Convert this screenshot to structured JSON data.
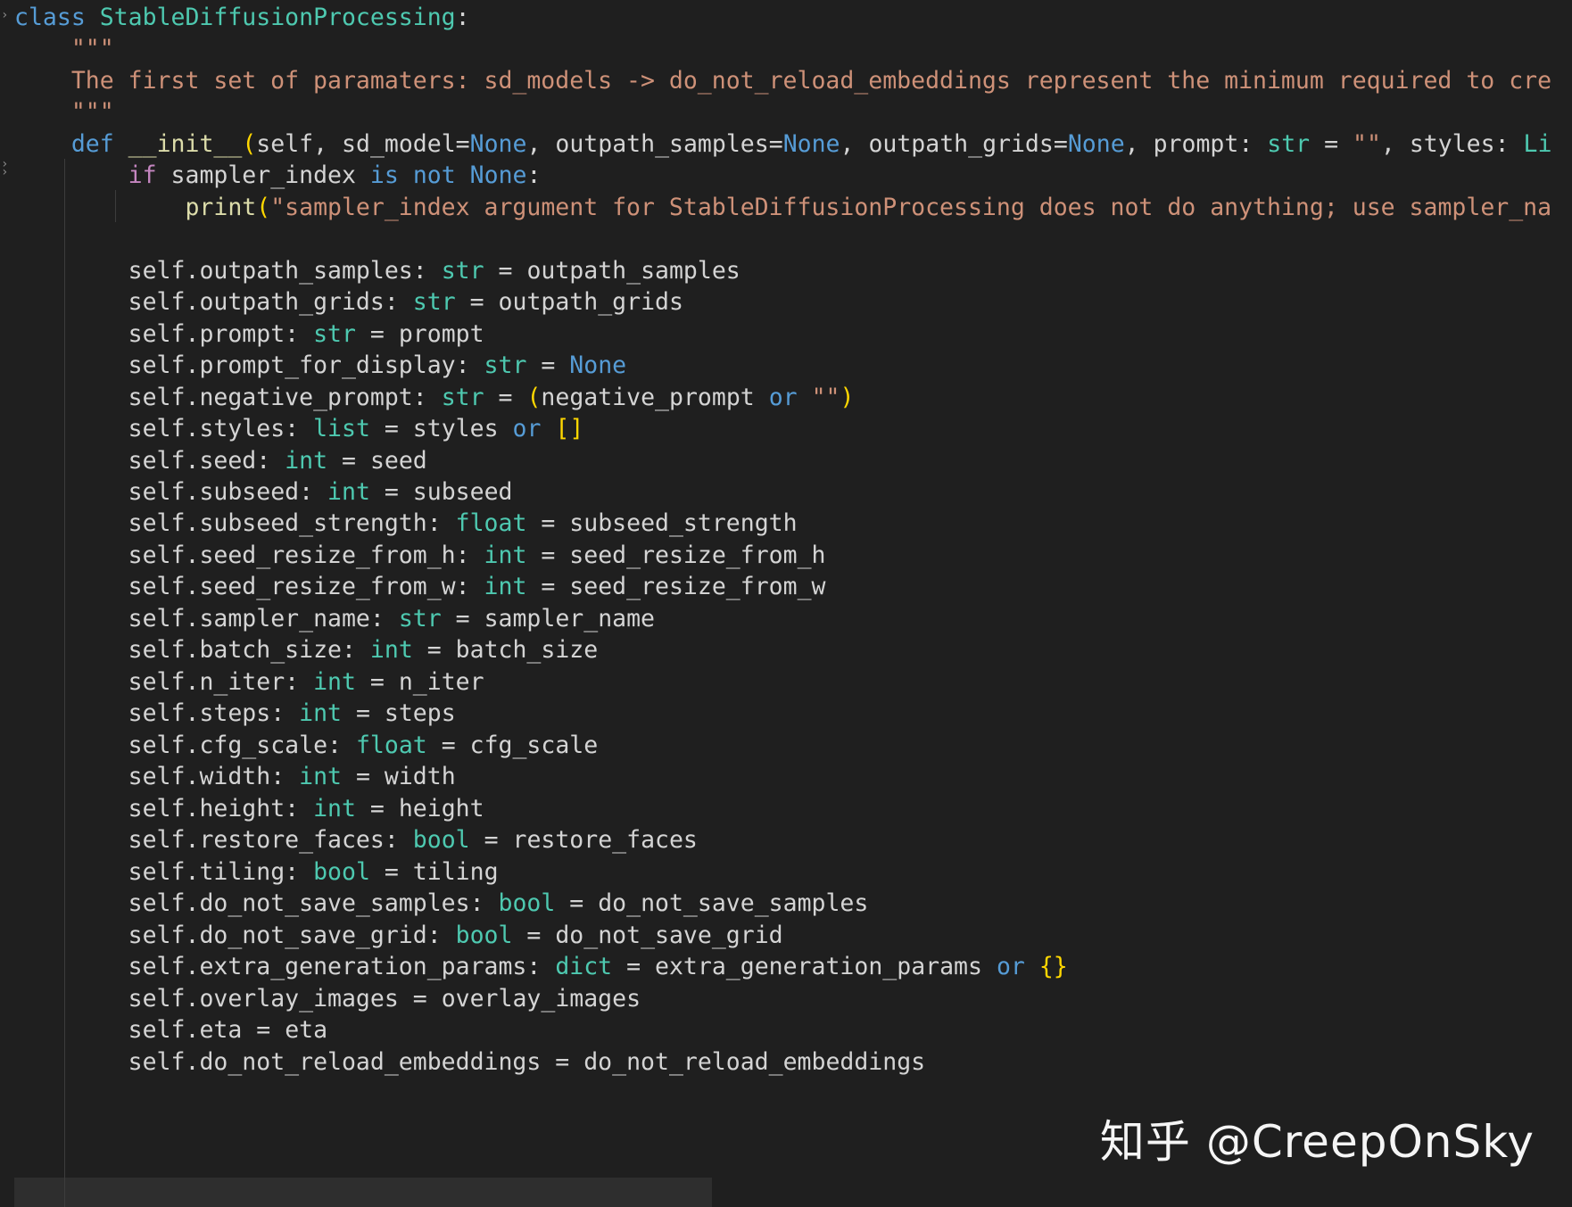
{
  "editor": {
    "language": "python",
    "lines": [
      "class StableDiffusionProcessing:",
      "    \"\"\"",
      "    The first set of paramaters: sd_models -> do_not_reload_embeddings represent the minimum required to cre",
      "    \"\"\"",
      "    def __init__(self, sd_model=None, outpath_samples=None, outpath_grids=None, prompt: str = \"\", styles: Li",
      "        if sampler_index is not None:",
      "            print(\"sampler_index argument for StableDiffusionProcessing does not do anything; use sampler_na",
      "",
      "        self.outpath_samples: str = outpath_samples",
      "        self.outpath_grids: str = outpath_grids",
      "        self.prompt: str = prompt",
      "        self.prompt_for_display: str = None",
      "        self.negative_prompt: str = (negative_prompt or \"\")",
      "        self.styles: list = styles or []",
      "        self.seed: int = seed",
      "        self.subseed: int = subseed",
      "        self.subseed_strength: float = subseed_strength",
      "        self.seed_resize_from_h: int = seed_resize_from_h",
      "        self.seed_resize_from_w: int = seed_resize_from_w",
      "        self.sampler_name: str = sampler_name",
      "        self.batch_size: int = batch_size",
      "        self.n_iter: int = n_iter",
      "        self.steps: int = steps",
      "        self.cfg_scale: float = cfg_scale",
      "        self.width: int = width",
      "        self.height: int = height",
      "        self.restore_faces: bool = restore_faces",
      "        self.tiling: bool = tiling",
      "        self.do_not_save_samples: bool = do_not_save_samples",
      "        self.do_not_save_grid: bool = do_not_save_grid",
      "        self.extra_generation_params: dict = extra_generation_params or {}",
      "        self.overlay_images = overlay_images",
      "        self.eta = eta",
      "        self.do_not_reload_embeddings = do_not_reload_embeddings"
    ]
  },
  "watermark": "知乎 @CreepOnSky",
  "colors": {
    "background": "#1f1f1f",
    "keyword": "#569cd6",
    "control": "#c586c0",
    "class": "#4ec9b0",
    "function": "#dcdcaa",
    "string": "#ce9178",
    "bracket": "#ffd700",
    "text": "#d4d4d4"
  }
}
